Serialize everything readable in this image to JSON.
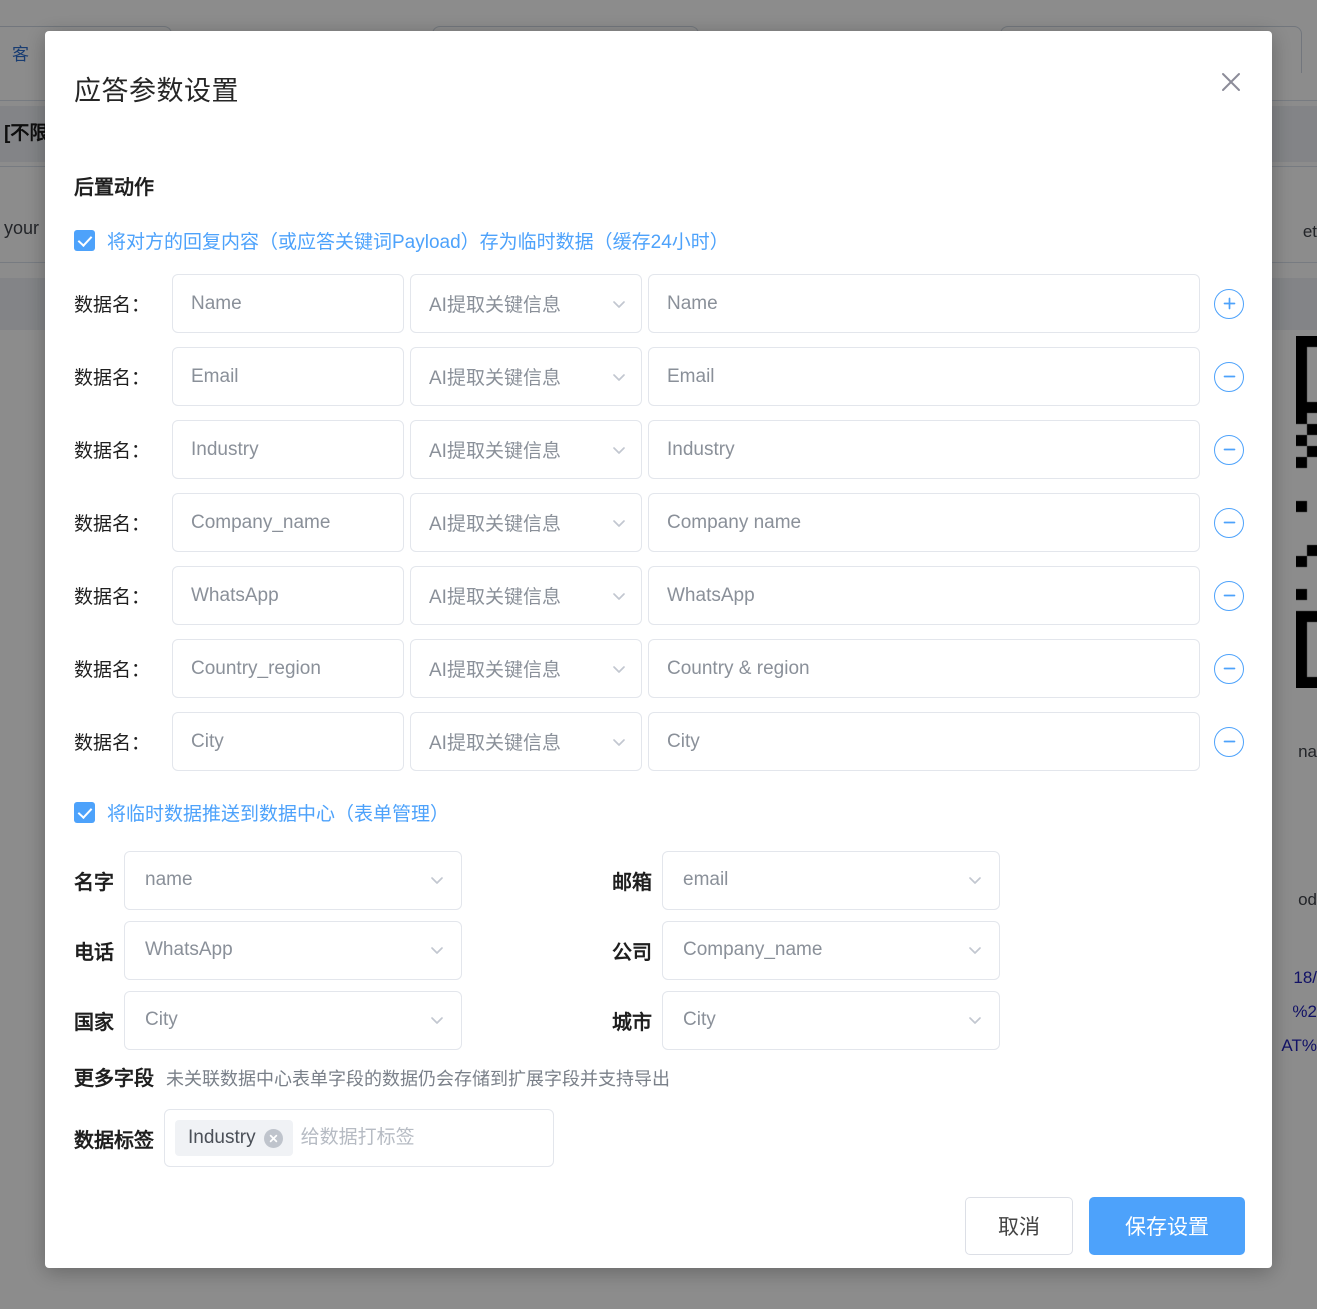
{
  "background": {
    "link_text": "客",
    "strong_text": "[不限",
    "your_text": "your",
    "right_texts": [
      "et",
      "na",
      "od",
      "18/",
      "%2",
      "AT%"
    ]
  },
  "dialog": {
    "title": "应答参数设置",
    "close_icon": "close-icon",
    "section_title": "后置动作",
    "checkbox_cache": {
      "checked": true,
      "label": "将对方的回复内容（或应答关键词Payload）存为临时数据（缓存24小时）"
    },
    "row_label": "数据名：",
    "mapping_rows": [
      {
        "name": "Name",
        "mode": "AI提取关键信息",
        "description": "Name",
        "action": "add"
      },
      {
        "name": "Email",
        "mode": "AI提取关键信息",
        "description": "Email",
        "action": "remove"
      },
      {
        "name": "Industry",
        "mode": "AI提取关键信息",
        "description": "Industry",
        "action": "remove"
      },
      {
        "name": "Company_name",
        "mode": "AI提取关键信息",
        "description": "Company name",
        "action": "remove"
      },
      {
        "name": "WhatsApp",
        "mode": "AI提取关键信息",
        "description": "WhatsApp",
        "action": "remove"
      },
      {
        "name": "Country_region",
        "mode": "AI提取关键信息",
        "description": "Country & region",
        "action": "remove"
      },
      {
        "name": "City",
        "mode": "AI提取关键信息",
        "description": "City",
        "action": "remove"
      }
    ],
    "checkbox_push": {
      "checked": true,
      "label": "将临时数据推送到数据中心（表单管理）"
    },
    "datacenter_fields": [
      {
        "label": "名字",
        "value": "name"
      },
      {
        "label": "邮箱",
        "value": "email"
      },
      {
        "label": "电话",
        "value": "WhatsApp"
      },
      {
        "label": "公司",
        "value": "Company_name"
      },
      {
        "label": "国家",
        "value": "City"
      },
      {
        "label": "城市",
        "value": "City"
      }
    ],
    "more_fields": {
      "label": "更多字段",
      "note": "未关联数据中心表单字段的数据仍会存储到扩展字段并支持导出"
    },
    "tags": {
      "label": "数据标签",
      "chips": [
        "Industry"
      ],
      "placeholder": "给数据打标签",
      "input_value": ""
    },
    "footer": {
      "cancel_label": "取消",
      "save_label": "保存设置"
    }
  },
  "colors": {
    "accent": "#4da2fb",
    "overlay": "rgba(0,0,0,0.45)",
    "border": "#e3e6ec",
    "placeholder_text": "#8a9099"
  }
}
